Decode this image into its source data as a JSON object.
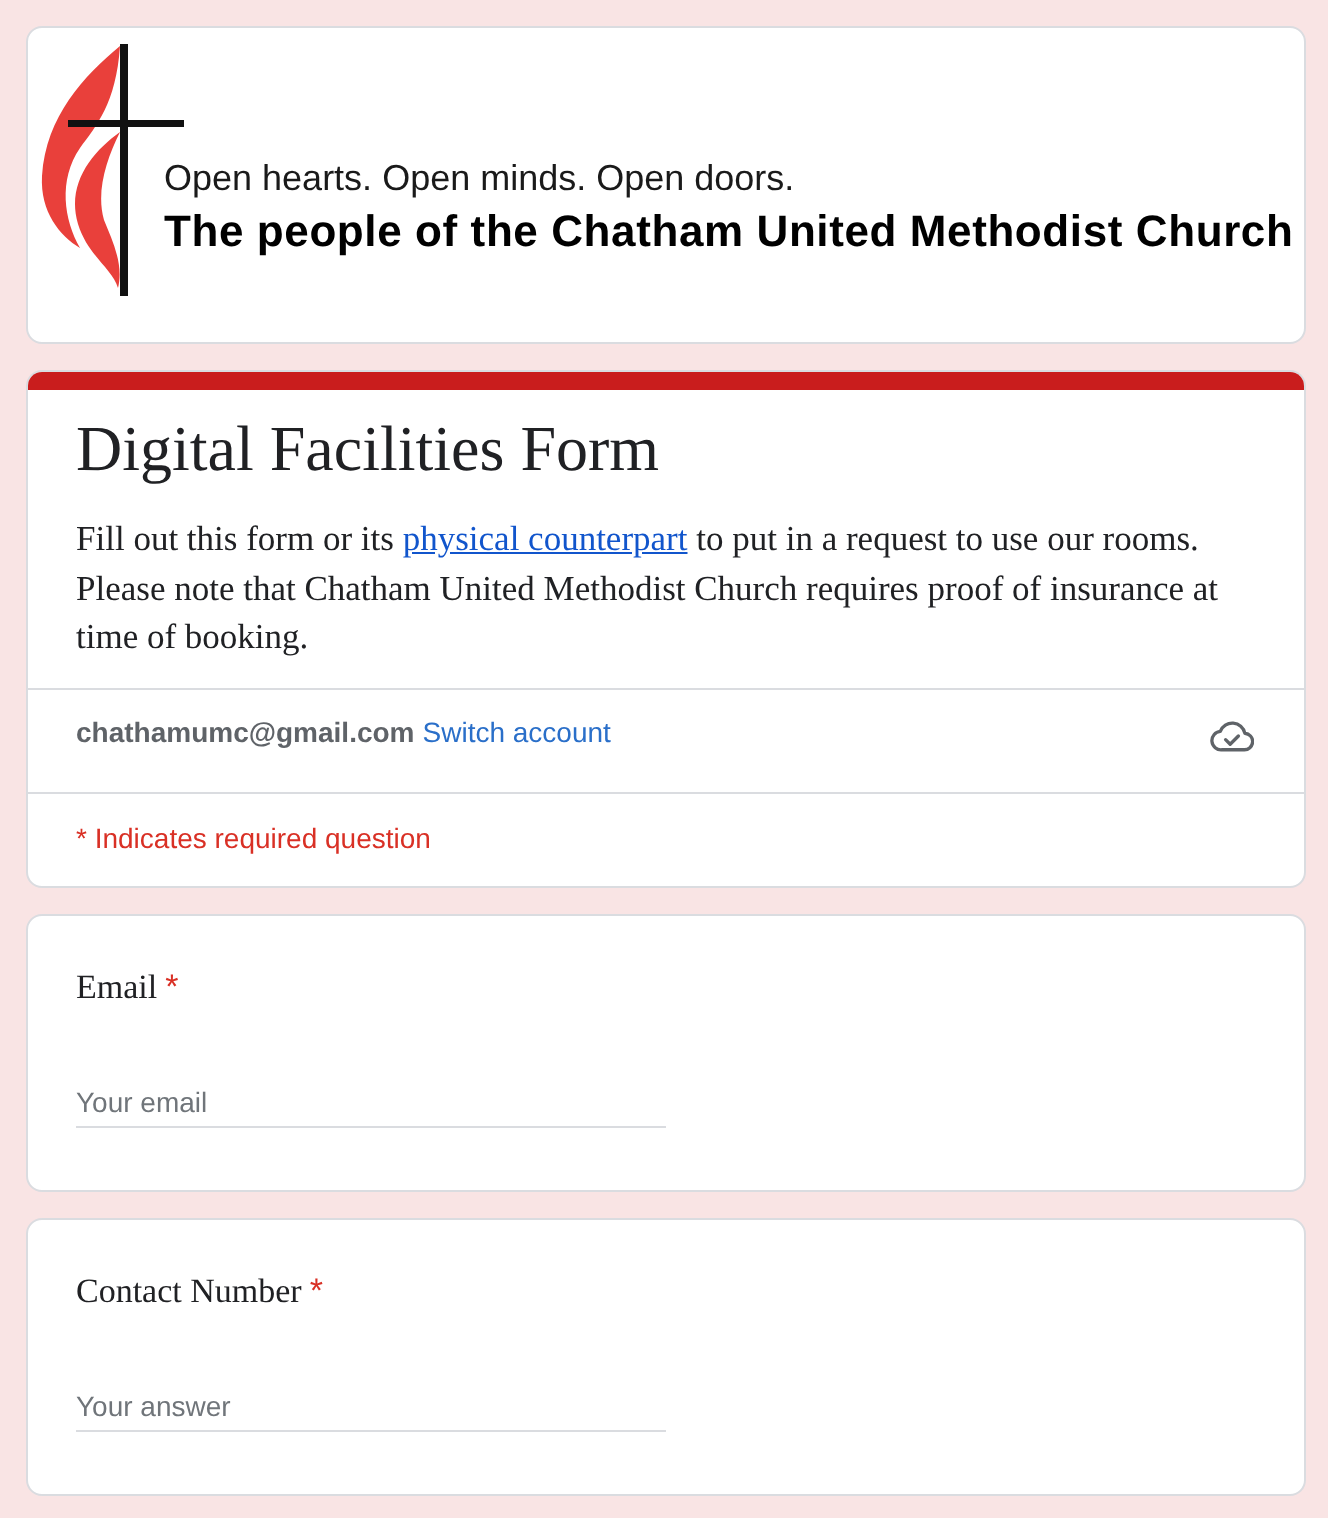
{
  "banner": {
    "tagline": "Open hearts. Open minds. Open doors.",
    "name": "The people of the Chatham United Methodist Church"
  },
  "form": {
    "title": "Digital Facilities Form",
    "description": [
      {
        "kind": "text",
        "text": "Fill out this form or its "
      },
      {
        "kind": "link",
        "text": "physical counterpart"
      },
      {
        "kind": "text",
        "text": " to put in a request to use our rooms. Please note that Chatham United Methodist Church requires proof of insurance at time of booking."
      }
    ],
    "account": {
      "email": "chathamumc@gmail.com",
      "switch_label": "Switch account"
    },
    "required_note": "* Indicates required question"
  },
  "questions": [
    {
      "label": "Email",
      "required_mark": "*",
      "placeholder": "Your email"
    },
    {
      "label": "Contact Number",
      "required_mark": "*",
      "placeholder": "Your answer"
    }
  ]
}
